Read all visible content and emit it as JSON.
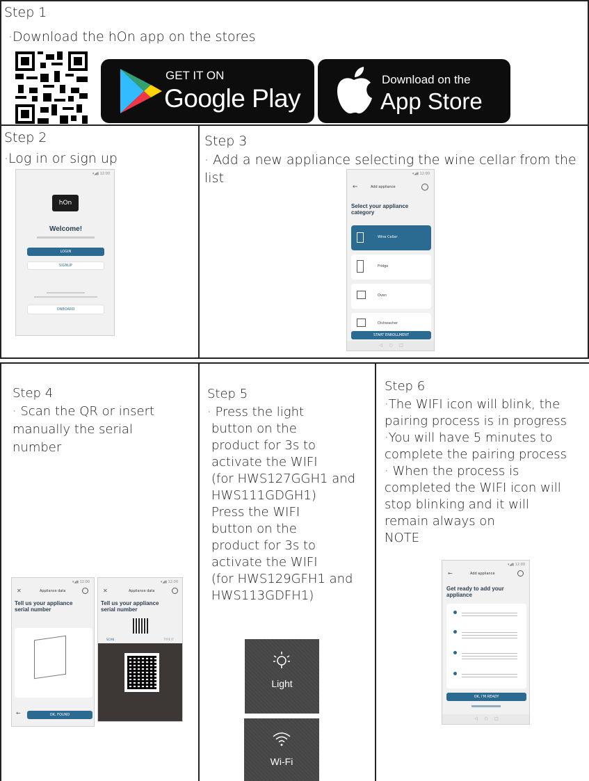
{
  "step1": {
    "title": "Step 1",
    "line": "·Download the hOn app on the stores",
    "google": {
      "small": "GET IT ON",
      "big": "Google Play"
    },
    "apple": {
      "small": "Download on the",
      "big": "App Store"
    }
  },
  "step2": {
    "title": "Step 2",
    "line": "·Log in or sign up",
    "phone": {
      "logo": "hOn",
      "welcome": "Welcome!",
      "login": "LOGIN",
      "signup": "SIGNUP",
      "onboard": "ONBOARD"
    }
  },
  "step3": {
    "title": "Step 3",
    "line1": "· Add a new appliance selecting the wine cellar from the",
    "line2": "list",
    "phone": {
      "header": "Add appliance",
      "heading": "Select your appliance category",
      "items": [
        "Wine Cellar",
        "Fridge",
        "Oven",
        "Dishwasher"
      ],
      "button": "START ENROLLMENT"
    }
  },
  "step4": {
    "title": "Step 4",
    "lines": [
      "· Scan the QR or insert",
      "manually the serial",
      "number"
    ],
    "phone1": {
      "header": "Appliance data",
      "heading": "Tell us your appliance serial number",
      "button": "OK, FOUND"
    },
    "phone2": {
      "header": "Appliance data",
      "heading": "Tell us your appliance serial number",
      "tab1": "SCAN",
      "tab2": "TYPE IT"
    }
  },
  "step5": {
    "title": "Step 5",
    "lines": [
      "· Press the light",
      "button on the",
      "product for 3s to",
      "activate the WIFI",
      "(for HWS127GGH1 and",
      "HWS111GDGH1)",
      "Press the WIFI",
      "button on the",
      "product for 3s to",
      "activate the WIFI",
      "(for HWS129GFH1 and",
      "HWS113GDFH1)"
    ],
    "light_label": "Light",
    "wifi_label": "Wi-Fi"
  },
  "step6": {
    "title": "Step 6",
    "lines": [
      "·The WIFI icon will blink, the",
      "pairing process is in progress",
      "·You will have 5 minutes to",
      "complete the pairing process",
      "· When the process is",
      "completed the WIFI icon will",
      "stop blinking and it will",
      "remain always on",
      "NOTE"
    ],
    "phone": {
      "header": "Add appliance",
      "heading": "Get ready to add your appliance",
      "button": "OK, I'M READY"
    }
  }
}
